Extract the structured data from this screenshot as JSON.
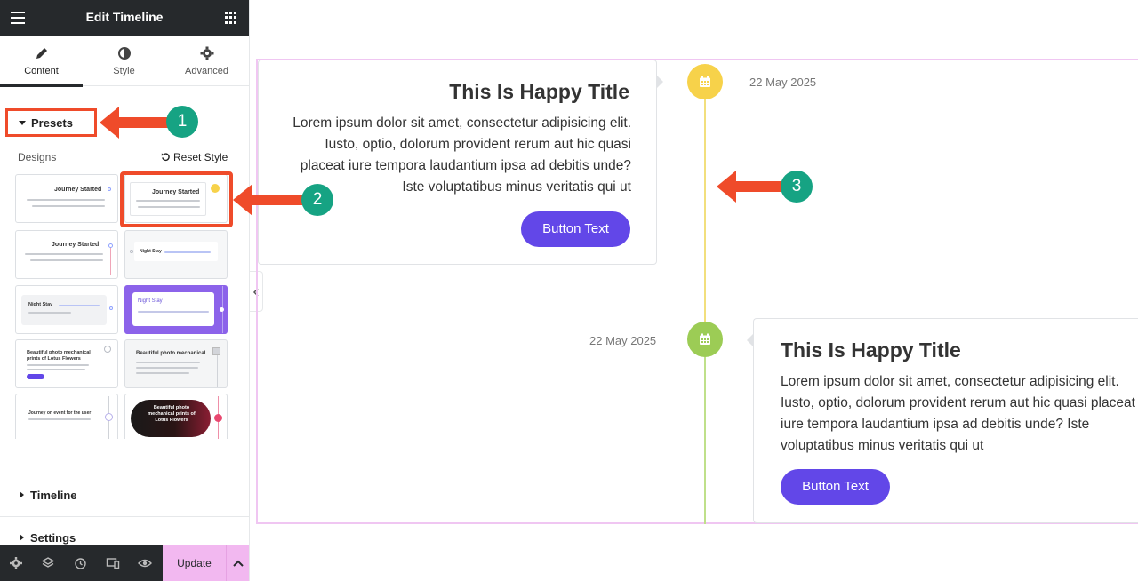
{
  "topbar": {
    "title": "Edit Timeline",
    "menu_icon": "hamburger-icon",
    "apps_icon": "grid-icon"
  },
  "tabs": [
    {
      "label": "Content",
      "icon": "pencil-icon",
      "active": true
    },
    {
      "label": "Style",
      "icon": "half-circle-icon",
      "active": false
    },
    {
      "label": "Advanced",
      "icon": "gear-icon",
      "active": false
    }
  ],
  "presets": {
    "heading": "Presets",
    "designs_label": "Designs",
    "reset_label": "Reset Style",
    "thumbnails": [
      {
        "title": "Journey Started",
        "text": "consectetur adipisicing elit. Iusto, optio, adipisicing elit hic quasi placeat iure"
      },
      {
        "title": "Journey Started",
        "text": "consectetur adipisicing elit. Iusto, optio, adipisicing elit hic quasi",
        "selected": true
      },
      {
        "title": "Journey Started",
        "text": "consectetur adipisicing elit. Iusto, optio, adipisicing elit hic quasi placeat iure"
      },
      {
        "title": "Night Stay",
        "text": "Completed Coffee Slice Martin"
      },
      {
        "title": "Night Stay",
        "text": "Completed Slice Martin regarding the Product"
      },
      {
        "title": "Night Stay",
        "text": "Completed Coffee Slice regarding"
      },
      {
        "title": "Beautiful photo mechanical prints of Lotus Flowers",
        "text": "Lorem ipsum dolor sit amet consectetur adipiscing"
      },
      {
        "title": "Beautiful photo mechanical",
        "text": "Wrapped all Datura Blossom regarding"
      },
      {
        "title": "Journey on event for the user",
        "text": ""
      },
      {
        "title": "Beautiful photo mechanical prints of Lotus Flowers",
        "text": ""
      }
    ]
  },
  "sections": {
    "timeline": "Timeline",
    "settings": "Settings"
  },
  "bottombar": {
    "update_label": "Update"
  },
  "canvas": {
    "items": [
      {
        "title": "This Is Happy Title",
        "body": "Lorem ipsum dolor sit amet, consectetur adipisicing elit. Iusto, optio, dolorum provident rerum aut hic quasi placeat iure tempora laudantium ipsa ad debitis unde? Iste voluptatibus minus veritatis qui ut",
        "button": "Button Text",
        "date": "22 May 2025",
        "icon_color": "#f7d24a"
      },
      {
        "title": "This Is Happy Title",
        "body": "Lorem ipsum dolor sit amet, consectetur adipisicing elit. Iusto, optio, dolorum provident rerum aut hic quasi placeat iure tempora laudantium ipsa ad debitis unde? Iste voluptatibus minus veritatis qui ut",
        "button": "Button Text",
        "date": "22 May 2025",
        "icon_color": "#9ccc55"
      }
    ]
  },
  "annotations": [
    "1",
    "2",
    "3"
  ],
  "colors": {
    "accent": "#6247e8",
    "annotation_arrow": "#ef4b2a",
    "badge": "#16a383",
    "frame": "#f0c6f2"
  }
}
